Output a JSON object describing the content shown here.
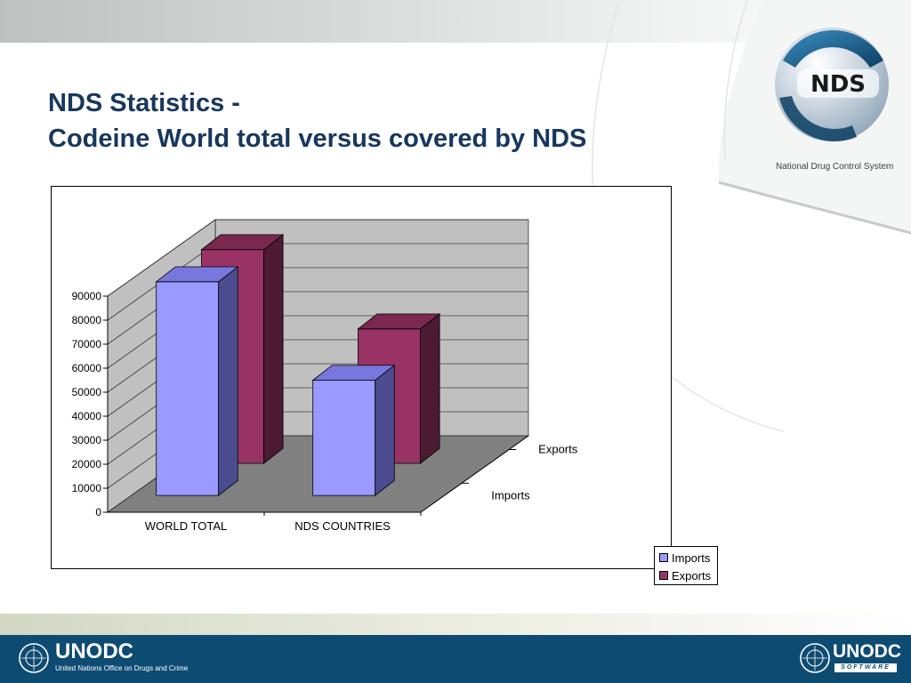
{
  "slide": {
    "title_line1": "NDS Statistics -",
    "title_line2": "Codeine World total versus covered by NDS"
  },
  "logo": {
    "text": "NDS",
    "caption": "National Drug Control System"
  },
  "footer": {
    "left_brand": "UNODC",
    "left_subtitle": "United Nations Office on Drugs and Crime",
    "right_brand": "UNODC",
    "right_subtitle": "SOFTWARE"
  },
  "colors": {
    "title": "#17375e",
    "footer": "#0e4b73",
    "imports_front": "#9999ff",
    "imports_side": "#4b4b8f",
    "imports_top": "#7777dd",
    "exports_front": "#993366",
    "exports_side": "#4d1a33",
    "exports_top": "#7a2850",
    "wall": "#c0c0c0",
    "floor": "#808080"
  },
  "chart_data": {
    "type": "bar",
    "three_d": true,
    "categories": [
      "WORLD TOTAL",
      "NDS COUNTRIES"
    ],
    "series": [
      {
        "name": "Imports",
        "values": [
          89000,
          48000
        ]
      },
      {
        "name": "Exports",
        "values": [
          89000,
          56000
        ]
      }
    ],
    "ylim": [
      0,
      90000
    ],
    "yticks": [
      "0",
      "10000",
      "20000",
      "30000",
      "40000",
      "50000",
      "60000",
      "70000",
      "80000",
      "90000"
    ],
    "depth_labels": [
      "Imports",
      "Exports"
    ],
    "grid": true,
    "legend": "right"
  }
}
